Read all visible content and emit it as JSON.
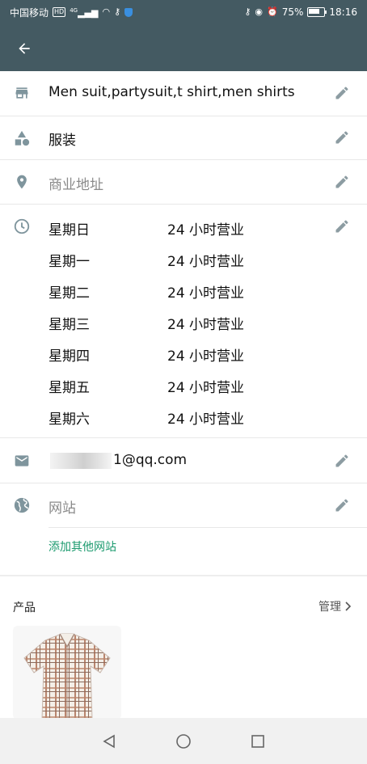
{
  "status_bar": {
    "carrier": "中国移动",
    "hd_badge": "HD",
    "network": "4G",
    "battery": "75%",
    "time": "18:16"
  },
  "business": {
    "name": "Men suit,partysuit,t shirt,men shirts",
    "category": "服装",
    "address_placeholder": "商业地址",
    "hours": [
      {
        "day": "星期日",
        "value": "24 小时营业"
      },
      {
        "day": "星期一",
        "value": "24 小时营业"
      },
      {
        "day": "星期二",
        "value": "24 小时营业"
      },
      {
        "day": "星期三",
        "value": "24 小时营业"
      },
      {
        "day": "星期四",
        "value": "24 小时营业"
      },
      {
        "day": "星期五",
        "value": "24 小时营业"
      },
      {
        "day": "星期六",
        "value": "24 小时营业"
      }
    ],
    "email_suffix": "1@qq.com",
    "website_placeholder": "网站",
    "add_website_label": "添加其他网站"
  },
  "products": {
    "title": "产品",
    "manage_label": "管理"
  },
  "colors": {
    "header": "#445a62",
    "icon": "#7f959d",
    "link": "#1b9a6e"
  },
  "icons": {
    "back": "arrow-left-icon",
    "name": "store-icon",
    "category": "shapes-icon",
    "address": "location-pin-icon",
    "hours": "clock-icon",
    "email": "email-icon",
    "website": "globe-icon",
    "edit": "pencil-icon"
  }
}
